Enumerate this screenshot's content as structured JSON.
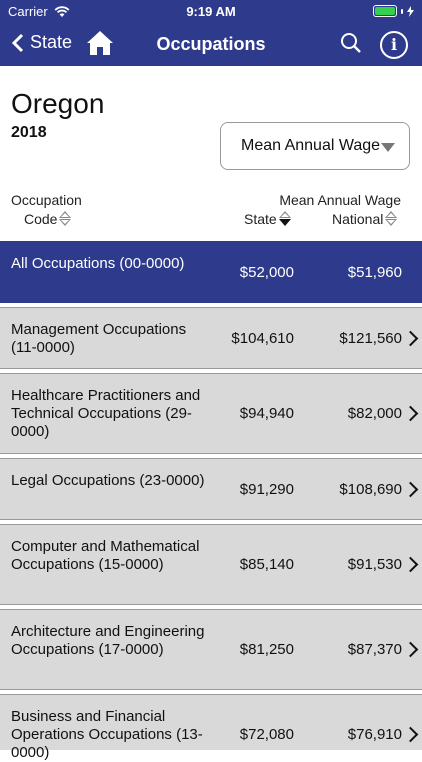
{
  "status": {
    "carrier": "Carrier",
    "time": "9:19 AM"
  },
  "nav": {
    "back_label": "State",
    "title": "Occupations"
  },
  "header": {
    "state": "Oregon",
    "year": "2018"
  },
  "wage_select": {
    "selected": "Mean Annual Wage"
  },
  "columns": {
    "occupation_line1": "Occupation",
    "occupation_line2": "Code",
    "wage_group": "Mean Annual Wage",
    "state": "State",
    "national": "National"
  },
  "all_row": {
    "name": "All Occupations (00-0000)",
    "state": "$52,000",
    "national": "$51,960"
  },
  "rows": [
    {
      "name": "Management Occupations (11-0000)",
      "state": "$104,610",
      "national": "$121,560"
    },
    {
      "name": "Healthcare Practitioners and Technical Occupations (29-0000)",
      "state": "$94,940",
      "national": "$82,000"
    },
    {
      "name": "Legal Occupations (23-0000)",
      "state": "$91,290",
      "national": "$108,690"
    },
    {
      "name": "Computer and Mathematical Occupations (15-0000)",
      "state": "$85,140",
      "national": "$91,530"
    },
    {
      "name": "Architecture and Engineering Occupations (17-0000)",
      "state": "$81,250",
      "national": "$87,370"
    },
    {
      "name": "Business and Financial Operations Occupations (13-0000)",
      "state": "$72,080",
      "national": "$76,910"
    }
  ],
  "colors": {
    "navy": "#2e3a8c",
    "row_bg": "#d9d9d9",
    "battery": "#35d04f"
  }
}
